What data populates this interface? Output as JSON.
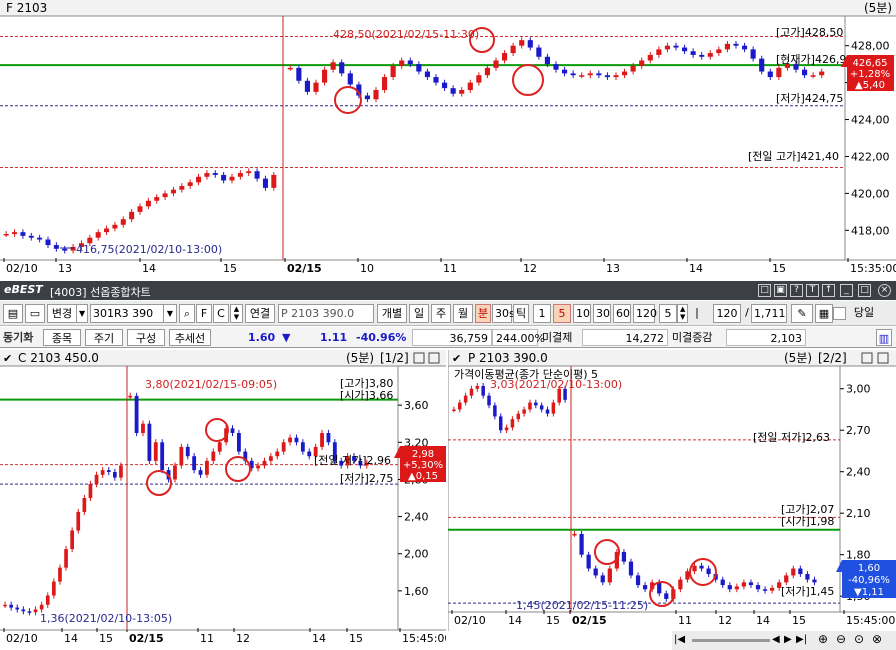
{
  "app": {
    "logo": "eBEST",
    "window_title": "[4003] 선옵종합차트"
  },
  "colors": {
    "up": "#dc1818",
    "down": "#1a1ac8",
    "high_line": "#d23232",
    "low_line": "#2a2a90",
    "prev_line": "#d23232",
    "ma_line": "#0a9a0a",
    "marker": "#dd2222",
    "title_bg": "#3d3f46",
    "axis_text": "#000000"
  },
  "toolbar": {
    "change_btn": "변경",
    "code": "301R3 390",
    "link_btn": "연결",
    "code_name": "P 2103 390.0",
    "tabs": [
      "개별",
      "일",
      "주",
      "월",
      "분",
      "30s",
      "틱"
    ],
    "selected_tab": "분",
    "intervals": [
      "1",
      "5",
      "10",
      "30",
      "60",
      "120"
    ],
    "selected_interval": "5",
    "period_value": "5",
    "count": "120",
    "total": "1,711",
    "single_day_label": "당일"
  },
  "infobar": {
    "sync_label": "동기화",
    "btn_item": "종목",
    "btn_period": "주기",
    "btn_compose": "구성",
    "btn_trend": "추세선",
    "price": "1.60",
    "change": "1.11",
    "change_pct": "-40.96%",
    "volume": "36,759",
    "volume_pct": "244.00%",
    "open_interest_label": "미결제",
    "open_interest": "14,272",
    "oi_change_label": "미결증감",
    "oi_change": "2,103"
  },
  "chart_f": {
    "title": "F 2103",
    "interval": "(5분)",
    "y_ticks": [
      "428,00",
      "426,00",
      "424,00",
      "422,00",
      "420,00",
      "418,00"
    ],
    "x_ticks": [
      "02/10",
      "13",
      "14",
      "15",
      "02/15",
      "10",
      "11",
      "12",
      "13",
      "14",
      "15",
      "15:35:00"
    ],
    "high_label": "[고가]428,50",
    "price_label": "[현재가]426,95",
    "low_label": "[저가]424,75",
    "prev_high_label": "[전일 고가]421,40",
    "high_annot": "428,50(2021/02/15-11:30)",
    "low_annot": "416,75(2021/02/10-13:00)",
    "current_box": [
      "426,65",
      "+1,28%",
      "▲5,40"
    ],
    "chart_data": {
      "type": "candlestick",
      "title": "F 2103",
      "y_range": [
        416.5,
        429.5
      ],
      "high": 428.5,
      "low_before_gap": 416.75,
      "prev_day_high": 421.4,
      "day_low": 424.75,
      "current": 426.65,
      "moving_avg": 426.95,
      "segment1_close": [
        417.8,
        417.9,
        417.7,
        417.6,
        417.5,
        417.2,
        417.0,
        416.9,
        417.1,
        417.3,
        417.6,
        417.9,
        418.1,
        418.3,
        418.6,
        419.0,
        419.3,
        419.6,
        419.8,
        420.0,
        420.2,
        420.4,
        420.6,
        420.9,
        421.1,
        421.0,
        420.7,
        420.9,
        421.1,
        421.2,
        420.8,
        420.3,
        421.0
      ],
      "segment2_close": [
        426.8,
        426.1,
        425.5,
        426.0,
        426.7,
        427.1,
        426.5,
        425.9,
        425.3,
        425.1,
        425.6,
        426.3,
        426.9,
        427.2,
        427.0,
        426.6,
        426.3,
        426.0,
        425.7,
        425.4,
        425.6,
        426.0,
        426.4,
        426.8,
        427.2,
        427.6,
        428.0,
        428.3,
        427.9,
        427.4,
        427.0,
        426.7,
        426.5,
        426.4,
        426.4,
        426.5,
        426.4,
        426.3,
        426.4,
        426.6,
        426.9,
        427.2,
        427.5,
        427.8,
        428.0,
        427.9,
        427.7,
        427.5,
        427.4,
        427.6,
        427.8,
        428.1,
        428.0,
        427.8,
        427.3,
        426.6,
        426.3,
        426.8,
        427.0,
        426.7,
        426.4,
        426.4,
        426.6
      ]
    }
  },
  "chart_c": {
    "title": "C 2103 450.0",
    "interval": "(5분)",
    "pager": "[1/2]",
    "y_ticks": [
      "3,60",
      "3,20",
      "2,80",
      "2,40",
      "2,00",
      "1,60"
    ],
    "x_ticks": [
      "02/10",
      "14",
      "15",
      "02/15",
      "11",
      "12",
      "14",
      "15",
      "15:45:00"
    ],
    "high_label": "[고가]3,80",
    "open_label": "[시가]3,66",
    "prev_low_label": "[전일 저가]2,96",
    "low_label": "[저가]2,75",
    "high_annot": "3,80(2021/02/15-09:05)",
    "low_annot": "1,36(2021/02/10-13:05)",
    "current_box": [
      "2,98",
      "+5,30%",
      "▲0,15"
    ],
    "chart_data": {
      "type": "candlestick",
      "title": "C 2103 450.0",
      "y_range": [
        1.2,
        4.0
      ],
      "high": 3.8,
      "low": 1.36,
      "segment1_close": [
        1.45,
        1.42,
        1.4,
        1.38,
        1.37,
        1.4,
        1.45,
        1.55,
        1.7,
        1.85,
        2.05,
        2.25,
        2.45,
        2.6,
        2.75,
        2.85,
        2.9,
        2.88,
        2.82,
        2.95
      ],
      "segment2_close": [
        3.7,
        3.3,
        3.4,
        3.0,
        3.2,
        2.9,
        2.8,
        2.95,
        3.15,
        3.05,
        2.9,
        2.85,
        3.0,
        3.1,
        3.2,
        3.35,
        3.3,
        3.1,
        3.0,
        2.92,
        2.95,
        3.0,
        3.05,
        3.1,
        3.2,
        3.25,
        3.2,
        3.1,
        3.05,
        3.15,
        3.3,
        3.2,
        3.0,
        2.95,
        3.05,
        3.0,
        2.95,
        2.98
      ]
    }
  },
  "chart_p": {
    "title": "P 2103 390.0",
    "interval": "(5분)",
    "pager": "[2/2]",
    "y_ticks": [
      "3,00",
      "2,70",
      "2,40",
      "2,10",
      "1,80",
      "1,50"
    ],
    "x_ticks": [
      "02/10",
      "14",
      "15",
      "02/15",
      "11",
      "12",
      "14",
      "15",
      "15:45:00"
    ],
    "legend": "가격이동평균(종가 단순이평) 5",
    "high_annot": "3,03(2021/02/10-13:00)",
    "low_annot": "1,45(2021/02/15-11:25)",
    "prev_low_label": "[전일 저가]2,63",
    "high_label": "[고가]2,07",
    "open_label": "[시가]1,98",
    "low_label": "[저가]1,45",
    "current_box": [
      "1,60",
      "-40,96%",
      "▼1,11"
    ],
    "chart_data": {
      "type": "candlestick",
      "title": "P 2103 390.0",
      "y_range": [
        1.4,
        3.15
      ],
      "high": 3.03,
      "low": 1.45,
      "segment1_close": [
        2.85,
        2.9,
        2.95,
        3.0,
        3.02,
        2.95,
        2.88,
        2.8,
        2.7,
        2.72,
        2.78,
        2.82,
        2.85,
        2.9,
        2.88,
        2.85,
        2.82,
        2.9,
        3.0,
        2.92
      ],
      "segment2_close": [
        1.95,
        1.8,
        1.7,
        1.65,
        1.6,
        1.7,
        1.82,
        1.75,
        1.65,
        1.58,
        1.55,
        1.6,
        1.52,
        1.48,
        1.55,
        1.62,
        1.68,
        1.72,
        1.7,
        1.66,
        1.62,
        1.58,
        1.55,
        1.57,
        1.6,
        1.58,
        1.55,
        1.54,
        1.56,
        1.6,
        1.65,
        1.7,
        1.66,
        1.62,
        1.6
      ]
    }
  }
}
